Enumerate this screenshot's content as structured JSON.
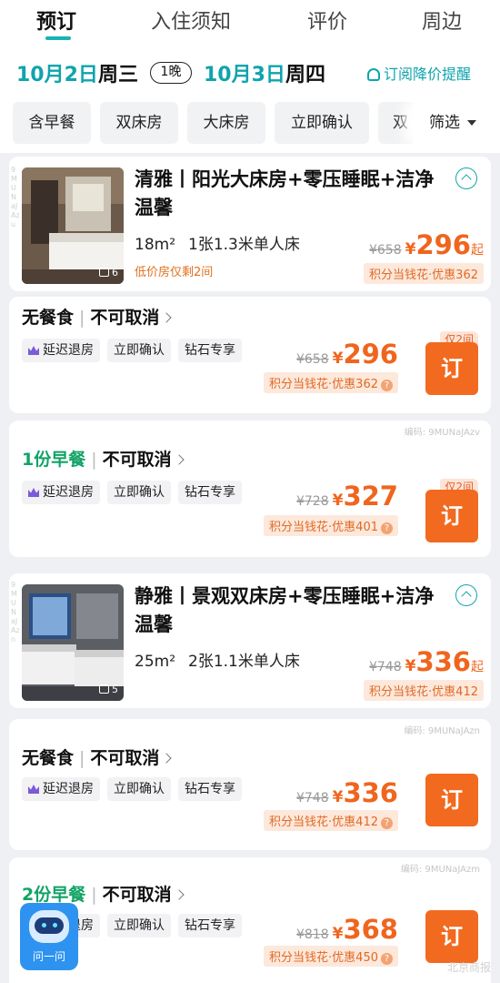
{
  "tabs": [
    "预订",
    "入住须知",
    "评价",
    "周边"
  ],
  "dates": {
    "checkin": "10月2日",
    "checkin_day": "周三",
    "nights": "1晚",
    "checkout": "10月3日",
    "checkout_day": "周四",
    "subscribe": "订阅降价提醒"
  },
  "filters": {
    "chips": [
      "含早餐",
      "双床房",
      "大床房",
      "立即确认",
      "双"
    ],
    "filter_label": "筛选"
  },
  "rooms": [
    {
      "name": "清雅丨阳光大床房+零压睡眠+洁净温馨",
      "area": "18m²",
      "bed": "1张1.3米单人床",
      "note": "低价房仅剩2间",
      "photo_count": "6",
      "orig_price": "¥658",
      "price": "296",
      "suffix": "起",
      "points": "积分当钱花·优惠362",
      "side_code": "9MUNaJAzu"
    },
    {
      "name": "静雅丨景观双床房+零压睡眠+洁净温馨",
      "area": "25m²",
      "bed": "2张1.1米单人床",
      "note": "",
      "photo_count": "5",
      "orig_price": "¥748",
      "price": "336",
      "suffix": "起",
      "points": "积分当钱花·优惠412",
      "side_code": "9MUNaJAzn"
    }
  ],
  "plans": [
    {
      "meal": "无餐食",
      "cancel": "不可取消",
      "tags": [
        "延迟退房",
        "立即确认",
        "钻石专享"
      ],
      "orig_price": "¥658",
      "price": "296",
      "points": "积分当钱花·优惠362",
      "badge": "仅2间",
      "book": "订",
      "code": ""
    },
    {
      "meal": "1份早餐",
      "cancel": "不可取消",
      "tags": [
        "延迟退房",
        "立即确认",
        "钻石专享"
      ],
      "orig_price": "¥728",
      "price": "327",
      "points": "积分当钱花·优惠401",
      "badge": "仅2间",
      "book": "订",
      "code": "编码: 9MUNaJAzv"
    },
    {
      "meal": "无餐食",
      "cancel": "不可取消",
      "tags": [
        "延迟退房",
        "立即确认",
        "钻石专享"
      ],
      "orig_price": "¥748",
      "price": "336",
      "points": "积分当钱花·优惠412",
      "badge": "",
      "book": "订",
      "code": "编码: 9MUNaJAzn"
    },
    {
      "meal": "2份早餐",
      "cancel": "不可取消",
      "tags": [
        "延迟退房",
        "立即确认",
        "钻石专享"
      ],
      "orig_price": "¥818",
      "price": "368",
      "points": "积分当钱花·优惠450",
      "badge": "",
      "book": "订",
      "code": "编码: 9MUNaJAzm"
    }
  ],
  "currency": "¥",
  "assistant_label": "问一问",
  "watermark": "北京商报",
  "colors": {
    "accent": "#19b3b5",
    "price": "#f0651e",
    "book_button": "#f26a1f",
    "breakfast": "#12a366"
  }
}
